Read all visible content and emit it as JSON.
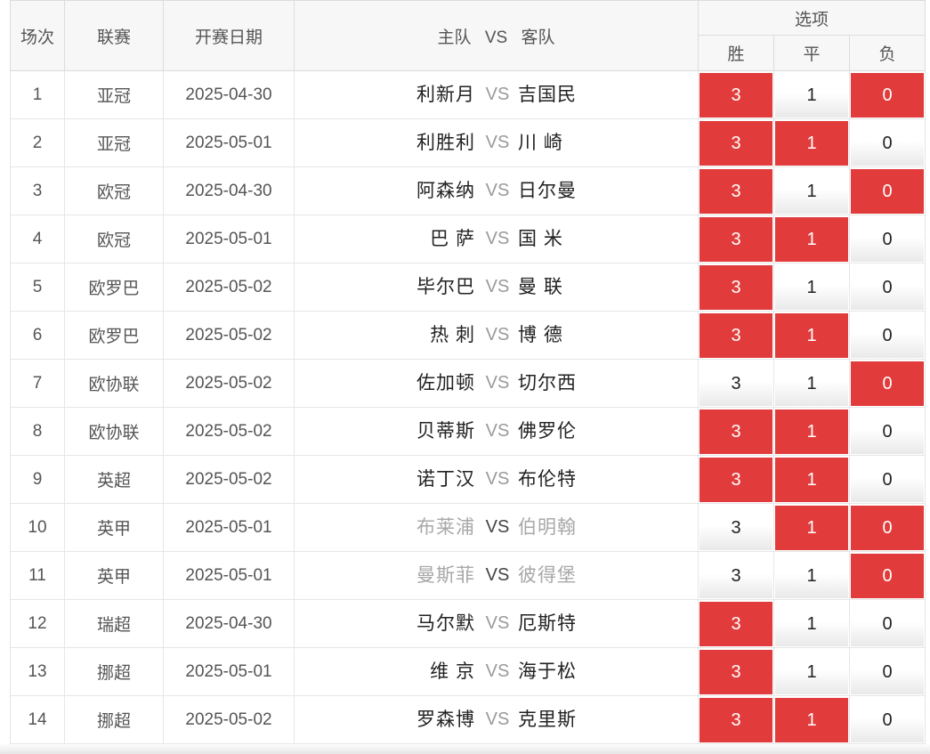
{
  "header": {
    "col_index": "场次",
    "col_league": "联赛",
    "col_date": "开赛日期",
    "col_home": "主队",
    "col_vs": "VS",
    "col_away": "客队",
    "col_options": "选项",
    "opt_win": "胜",
    "opt_draw": "平",
    "opt_lose": "负"
  },
  "option_labels": [
    "3",
    "1",
    "0"
  ],
  "colors": {
    "selected": "#e23b3b",
    "header_bg": "#f7f7f7"
  },
  "rows": [
    {
      "index": "1",
      "league": "亚冠",
      "date": "2025-04-30",
      "home": "利新月",
      "vs": "VS",
      "away": "吉国民",
      "win_selected": true,
      "draw_selected": false,
      "lose_selected": true,
      "dim": false
    },
    {
      "index": "2",
      "league": "亚冠",
      "date": "2025-05-01",
      "home": "利胜利",
      "vs": "VS",
      "away": "川 崎",
      "win_selected": true,
      "draw_selected": true,
      "lose_selected": false,
      "dim": false
    },
    {
      "index": "3",
      "league": "欧冠",
      "date": "2025-04-30",
      "home": "阿森纳",
      "vs": "VS",
      "away": "日尔曼",
      "win_selected": true,
      "draw_selected": false,
      "lose_selected": true,
      "dim": false
    },
    {
      "index": "4",
      "league": "欧冠",
      "date": "2025-05-01",
      "home": "巴 萨",
      "vs": "VS",
      "away": "国 米",
      "win_selected": true,
      "draw_selected": true,
      "lose_selected": false,
      "dim": false
    },
    {
      "index": "5",
      "league": "欧罗巴",
      "date": "2025-05-02",
      "home": "毕尔巴",
      "vs": "VS",
      "away": "曼 联",
      "win_selected": true,
      "draw_selected": false,
      "lose_selected": false,
      "dim": false
    },
    {
      "index": "6",
      "league": "欧罗巴",
      "date": "2025-05-02",
      "home": "热 刺",
      "vs": "VS",
      "away": "博 德",
      "win_selected": true,
      "draw_selected": true,
      "lose_selected": false,
      "dim": false
    },
    {
      "index": "7",
      "league": "欧协联",
      "date": "2025-05-02",
      "home": "佐加顿",
      "vs": "VS",
      "away": "切尔西",
      "win_selected": false,
      "draw_selected": false,
      "lose_selected": true,
      "dim": false
    },
    {
      "index": "8",
      "league": "欧协联",
      "date": "2025-05-02",
      "home": "贝蒂斯",
      "vs": "VS",
      "away": "佛罗伦",
      "win_selected": true,
      "draw_selected": true,
      "lose_selected": false,
      "dim": false
    },
    {
      "index": "9",
      "league": "英超",
      "date": "2025-05-02",
      "home": "诺丁汉",
      "vs": "VS",
      "away": "布伦特",
      "win_selected": true,
      "draw_selected": true,
      "lose_selected": false,
      "dim": false
    },
    {
      "index": "10",
      "league": "英甲",
      "date": "2025-05-01",
      "home": "布莱浦",
      "vs": "VS",
      "away": "伯明翰",
      "win_selected": false,
      "draw_selected": true,
      "lose_selected": true,
      "dim": true
    },
    {
      "index": "11",
      "league": "英甲",
      "date": "2025-05-01",
      "home": "曼斯菲",
      "vs": "VS",
      "away": "彼得堡",
      "win_selected": false,
      "draw_selected": false,
      "lose_selected": true,
      "dim": true
    },
    {
      "index": "12",
      "league": "瑞超",
      "date": "2025-04-30",
      "home": "马尔默",
      "vs": "VS",
      "away": "厄斯特",
      "win_selected": true,
      "draw_selected": false,
      "lose_selected": false,
      "dim": false
    },
    {
      "index": "13",
      "league": "挪超",
      "date": "2025-05-01",
      "home": "维 京",
      "vs": "VS",
      "away": "海于松",
      "win_selected": true,
      "draw_selected": false,
      "lose_selected": false,
      "dim": false
    },
    {
      "index": "14",
      "league": "挪超",
      "date": "2025-05-02",
      "home": "罗森博",
      "vs": "VS",
      "away": "克里斯",
      "win_selected": true,
      "draw_selected": true,
      "lose_selected": false,
      "dim": false
    }
  ]
}
